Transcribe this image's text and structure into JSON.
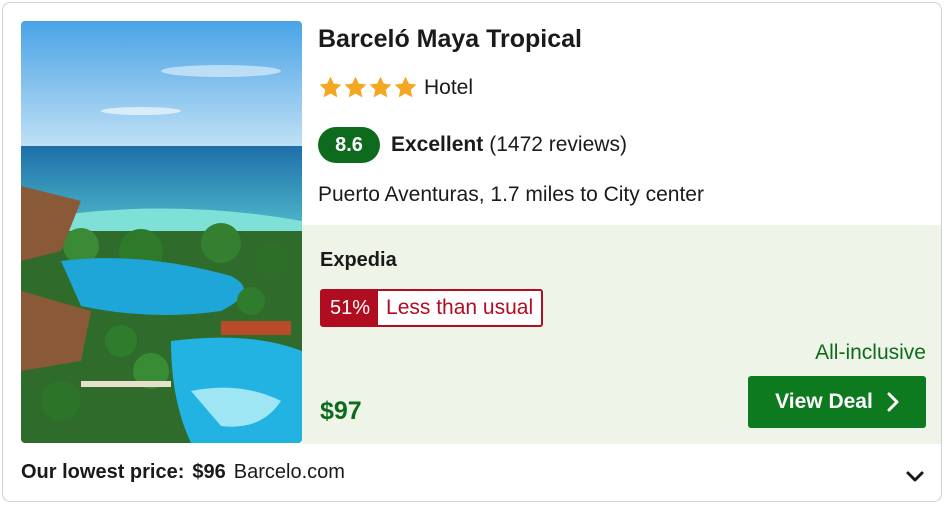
{
  "hotel": {
    "name": "Barceló Maya Tropical",
    "stars": 4,
    "type": "Hotel",
    "rating_score": "8.6",
    "rating_word": "Excellent",
    "reviews": "(1472 reviews)",
    "location": "Puerto Aventuras, 1.7 miles to City center"
  },
  "deal": {
    "provider": "Expedia",
    "discount_percent": "51%",
    "discount_label": "Less than usual",
    "board": "All-inclusive",
    "price": "$97",
    "button_label": "View Deal"
  },
  "footer": {
    "lowest_label": "Our lowest price:",
    "lowest_price": "$96",
    "lowest_site": "Barcelo.com"
  },
  "icons": {
    "star": "star-icon",
    "chevron_right": "chevron-right-icon",
    "chevron_down": "chevron-down-icon"
  },
  "colors": {
    "brand_green": "#0e6b1d",
    "button_green": "#0e7a1f",
    "deal_bg": "#eef5e8",
    "discount_red": "#b00d20",
    "star_orange": "#f5a623"
  }
}
